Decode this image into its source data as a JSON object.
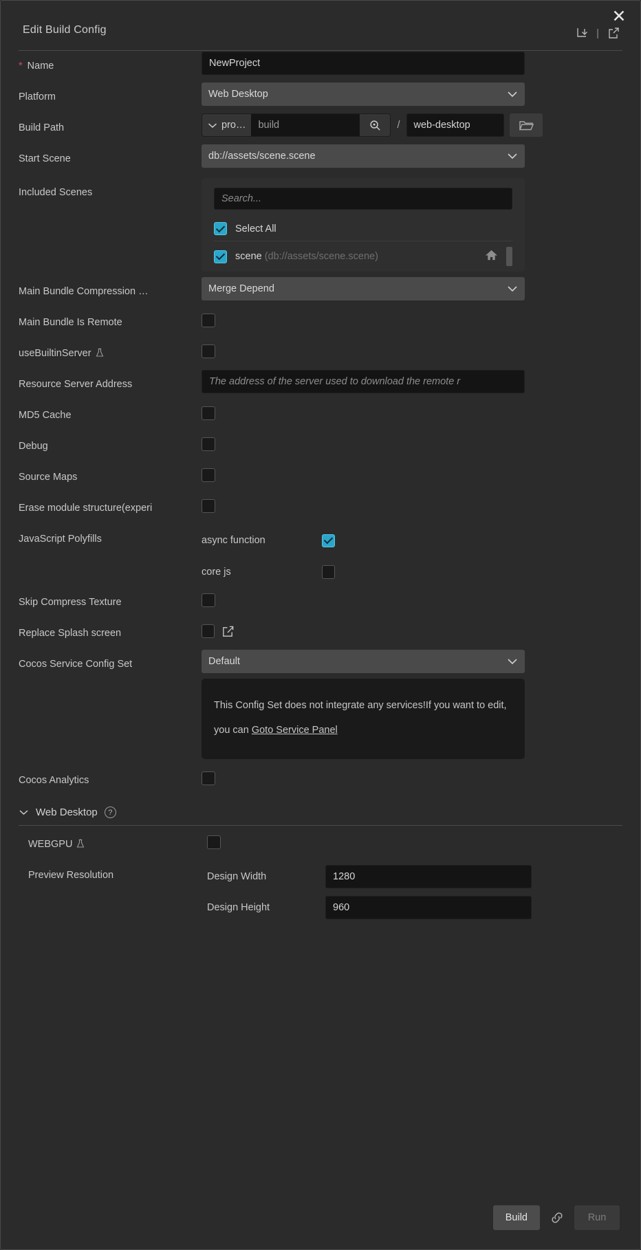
{
  "window": {
    "title": "Edit Build Config",
    "close_label": "✕",
    "import_icon": "import-config-icon",
    "export_icon": "export-config-icon",
    "separator": "|"
  },
  "fields": {
    "name": {
      "label": "Name",
      "required_mark": "*",
      "value": "NewProject"
    },
    "platform": {
      "label": "Platform",
      "value": "Web Desktop"
    },
    "build_path": {
      "label": "Build Path",
      "prefix": "pro…",
      "middle_value": "build",
      "separator": "/",
      "folder_value": "web-desktop"
    },
    "start_scene": {
      "label": "Start Scene",
      "value": "db://assets/scene.scene"
    },
    "included_scenes": {
      "label": "Included Scenes",
      "search_placeholder": "Search...",
      "select_all_label": "Select All",
      "select_all_checked": true,
      "items": [
        {
          "name": "scene",
          "path": "(db://assets/scene.scene)",
          "checked": true
        }
      ]
    },
    "main_bundle_compression": {
      "label": "Main Bundle Compression …",
      "value": "Merge Depend"
    },
    "main_bundle_is_remote": {
      "label": "Main Bundle Is Remote",
      "checked": false
    },
    "use_builtin_server": {
      "label": "useBuiltinServer",
      "checked": false,
      "experimental": true
    },
    "resource_server_address": {
      "label": "Resource Server Address",
      "placeholder": "The address of the server used to download the remote r",
      "value": ""
    },
    "md5_cache": {
      "label": "MD5 Cache",
      "checked": false
    },
    "debug": {
      "label": "Debug",
      "checked": false
    },
    "source_maps": {
      "label": "Source Maps",
      "checked": false
    },
    "erase_module_structure": {
      "label": "Erase module structure(experi",
      "checked": false
    },
    "javascript_polyfills": {
      "label": "JavaScript Polyfills",
      "options": [
        {
          "label": "async function",
          "checked": true
        },
        {
          "label": "core js",
          "checked": false
        }
      ]
    },
    "skip_compress_texture": {
      "label": "Skip Compress Texture",
      "checked": false
    },
    "replace_splash_screen": {
      "label": "Replace Splash screen",
      "checked": false,
      "edit_icon": "edit-pencil-icon"
    },
    "cocos_service_config_set": {
      "label": "Cocos Service Config Set",
      "value": "Default",
      "note_text": "This Config Set does not integrate any services!If you want to edit, you can ",
      "note_link": "Goto Service Panel"
    },
    "cocos_analytics": {
      "label": "Cocos Analytics",
      "checked": false
    }
  },
  "web_desktop_section": {
    "title": "Web Desktop",
    "help_glyph": "?",
    "webgpu": {
      "label": "WEBGPU",
      "checked": false,
      "experimental": true
    },
    "preview_resolution": {
      "label": "Preview Resolution",
      "design_width": {
        "label": "Design Width",
        "value": "1280"
      },
      "design_height": {
        "label": "Design Height",
        "value": "960"
      }
    }
  },
  "footer": {
    "build_label": "Build",
    "link_icon": "link-chain-icon",
    "run_label": "Run"
  },
  "colors": {
    "accent": "#2ba6cb",
    "required": "#d1495b",
    "panel_bg": "#2b2b2b",
    "input_bg": "#141414",
    "select_bg": "#4a4a4a"
  }
}
